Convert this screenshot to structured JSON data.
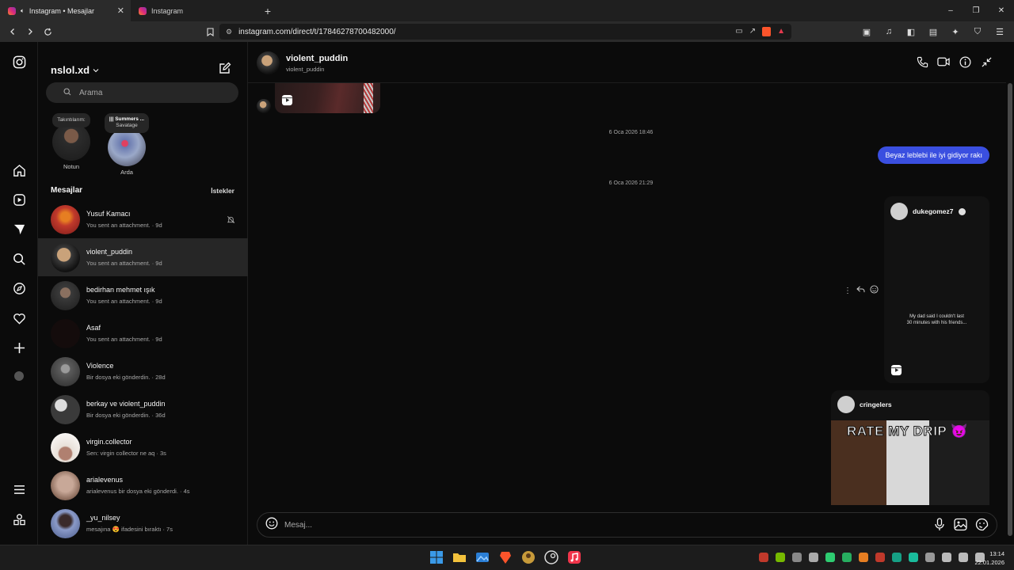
{
  "browser": {
    "tabs": [
      {
        "label": "Instagram • Mesajlar",
        "active": true
      },
      {
        "label": "Instagram",
        "active": false
      }
    ],
    "url": "instagram.com/direct/t/17846278700482000/",
    "new_tab": "+",
    "win_minimize": "–",
    "win_restore": "❐",
    "win_close": "✕"
  },
  "inbox": {
    "username": "nslol.xd",
    "search_placeholder": "Arama",
    "notes": [
      {
        "bubble": "Takıntılarım:",
        "song": "",
        "artist": "",
        "name": "Notun"
      },
      {
        "bubble": "",
        "song": "Summers ...",
        "artist": "Savatage",
        "name": "Arda"
      }
    ],
    "section_title": "Mesajlar",
    "requests_label": "İstekler",
    "conversations": [
      {
        "name": "Yusuf Kamacı",
        "preview": "You sent an attachment. · 9d",
        "avatar_color": "#c0392b",
        "muted": true
      },
      {
        "name": "violent_puddin",
        "preview": "You sent an attachment. · 9d",
        "avatar_color": "#6b5a4a",
        "selected": true
      },
      {
        "name": "bedirhan mehmet ışık",
        "preview": "You sent an attachment. · 9d",
        "avatar_color": "#3a3a3a"
      },
      {
        "name": "Asaf",
        "preview": "You sent an attachment. · 9d",
        "avatar_color": "#141010"
      },
      {
        "name": "Violence",
        "preview": "Bir dosya eki gönderdin. · 28d",
        "avatar_color": "#5b5b5b"
      },
      {
        "name": "berkay ve violent_puddin",
        "preview": "Bir dosya eki gönderdin. · 36d",
        "avatar_color": "#4a4a4a"
      },
      {
        "name": "virgin.collector",
        "preview": "Sen: virgin collector ne aq · 3s",
        "avatar_color": "#c9b8a8"
      },
      {
        "name": "arialevenus",
        "preview": "arialevenus bir dosya eki gönderdi. · 4s",
        "avatar_color": "#a88a7a"
      },
      {
        "name": "_yu_nilsey",
        "preview": "mesajına 😍 ifadesini bıraktı · 7s",
        "avatar_color": "#7a6a8a"
      }
    ]
  },
  "chat": {
    "name": "violent_puddin",
    "subtitle": "violent_puddin",
    "timestamp_1": "6 Oca 2026 18:46",
    "outgoing_message": "Beyaz leblebi ile iyi gidiyor rakı",
    "timestamp_2": "6 Oca 2026 21:29",
    "reel_user": "dukegomez7",
    "reel_caption_1": "My dad said I couldn't last",
    "reel_caption_2": "30 minutes with his friends...",
    "post_user": "cringelers",
    "post_title": "RATE MY DRIP 😈",
    "composer_placeholder": "Mesaj..."
  },
  "taskbar": {
    "time": "13:14",
    "date": "22.01.2026"
  },
  "colors": {
    "outgoing_bubble": "#3a4fe0",
    "background": "#0b0b0b",
    "selected_row": "#262626"
  }
}
